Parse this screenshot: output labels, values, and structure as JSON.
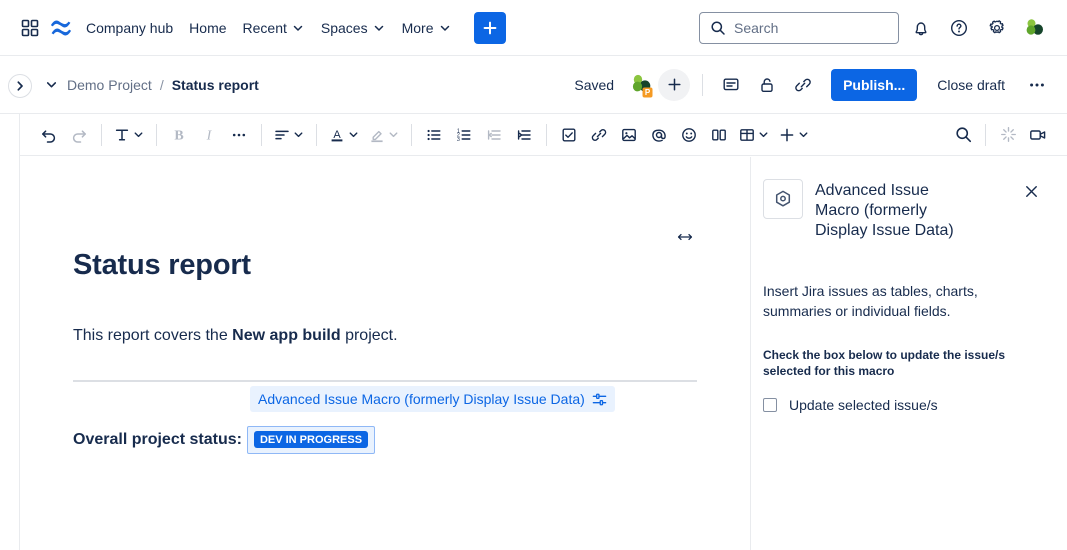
{
  "topnav": {
    "app_switcher_icon": "app-switcher-icon",
    "logo_icon": "confluence-logo-icon",
    "items": [
      {
        "label": "Company hub",
        "has_chevron": false
      },
      {
        "label": "Home",
        "has_chevron": false
      },
      {
        "label": "Recent",
        "has_chevron": true
      },
      {
        "label": "Spaces",
        "has_chevron": true
      },
      {
        "label": "More",
        "has_chevron": true
      }
    ],
    "create_label": "+",
    "search": {
      "placeholder": "Search",
      "value": ""
    },
    "notifications_icon": "bell-icon",
    "help_icon": "help-icon",
    "settings_icon": "gear-icon",
    "profile_icon": "user-avatar"
  },
  "subheader": {
    "expand_icon": "chevron-right-icon",
    "breadcrumb_chevron": "chevron-down-icon",
    "breadcrumb_parent": "Demo Project",
    "breadcrumb_separator": "/",
    "breadcrumb_current": "Status report",
    "saved_status": "Saved",
    "collaborator_avatar": "collaborator-avatar",
    "add_people_icon": "+",
    "comment_icon": "comment-icon",
    "restrictions_icon": "unlock-icon",
    "copy_link_icon": "link-icon",
    "publish_label": "Publish...",
    "close_draft_label": "Close draft",
    "more_actions_icon": "more-horizontal-icon"
  },
  "toolbar": {
    "undo": "undo-icon",
    "redo": "redo-icon",
    "text_style": "T",
    "text_style_chevron": "chevron-down-icon",
    "bold": "B",
    "italic": "I",
    "more_formatting": "more-horizontal-icon",
    "alignment": "align-icon",
    "alignment_chevron": "chevron-down-icon",
    "text_color": "A",
    "text_color_chevron": "chevron-down-icon",
    "highlight": "highlighter-icon",
    "highlight_chevron": "chevron-down-icon",
    "bullet_list": "bullet-list-icon",
    "numbered_list": "numbered-list-icon",
    "outdent": "outdent-icon",
    "indent": "indent-icon",
    "task_list": "checkbox-icon",
    "link": "link-icon",
    "image": "image-icon",
    "mention": "mention-icon",
    "emoji": "emoji-icon",
    "layouts": "layouts-icon",
    "table": "table-icon",
    "table_chevron": "chevron-down-icon",
    "insert_more": "plus-icon",
    "insert_more_chevron": "chevron-down-icon",
    "find_replace": "search-icon",
    "ai_icon": "ai-sparkle-icon",
    "video_icon": "video-icon"
  },
  "document": {
    "resize_handle_icon": "horizontal-resize-icon",
    "title": "Status report",
    "paragraph_prefix": "This report covers the ",
    "paragraph_bold": "New app build",
    "paragraph_suffix": " project.",
    "macro_label": "Advanced Issue Macro (formerly Display Issue Data)",
    "macro_config_icon": "macro-settings-icon",
    "status_label": "Overall project status:",
    "status_badge": "DEV IN PROGRESS"
  },
  "right_panel": {
    "macro_icon": "macro-hexagon-icon",
    "title": "Advanced Issue Macro (formerly Display Issue Data)",
    "close_icon": "close-icon",
    "description": "Insert Jira issues as tables, charts, summaries or individual fields.",
    "checkbox_heading": "Check the box below to update the issue/s selected for this macro",
    "checkbox_label": "Update selected issue/s",
    "checkbox_checked": false
  },
  "colors": {
    "brand_blue": "#0C66E4",
    "badge_blue": "#0C66E4",
    "macro_bg": "#E9F2FE",
    "macro_text": "#0C66E4",
    "border": "#E9EBEE",
    "text": "#172B4D",
    "subtle_text": "#626F86"
  }
}
